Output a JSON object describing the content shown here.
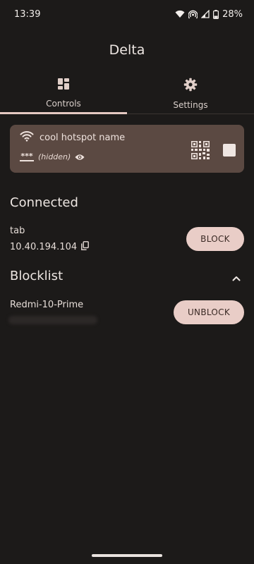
{
  "status_bar": {
    "time": "13:39",
    "battery": "28%"
  },
  "app": {
    "title": "Delta"
  },
  "tabs": [
    {
      "label": "Controls",
      "icon": "dashboard-icon",
      "selected": true
    },
    {
      "label": "Settings",
      "icon": "gear-icon",
      "selected": false
    }
  ],
  "hotspot": {
    "name": "cool hotspot name",
    "password_mask": "***",
    "password_state": "(hidden)",
    "enabled": false
  },
  "connected": {
    "header": "Connected",
    "devices": [
      {
        "name": "tab",
        "ip": "10.40.194.104",
        "action": "BLOCK"
      }
    ]
  },
  "blocklist": {
    "header": "Blocklist",
    "expanded": true,
    "devices": [
      {
        "name": "Redmi-10-Prime",
        "action": "UNBLOCK"
      }
    ]
  },
  "colors": {
    "background": "#1c1a19",
    "card": "#5b4942",
    "accent": "#e9cdc7",
    "indicator": "#e5c9c2"
  }
}
